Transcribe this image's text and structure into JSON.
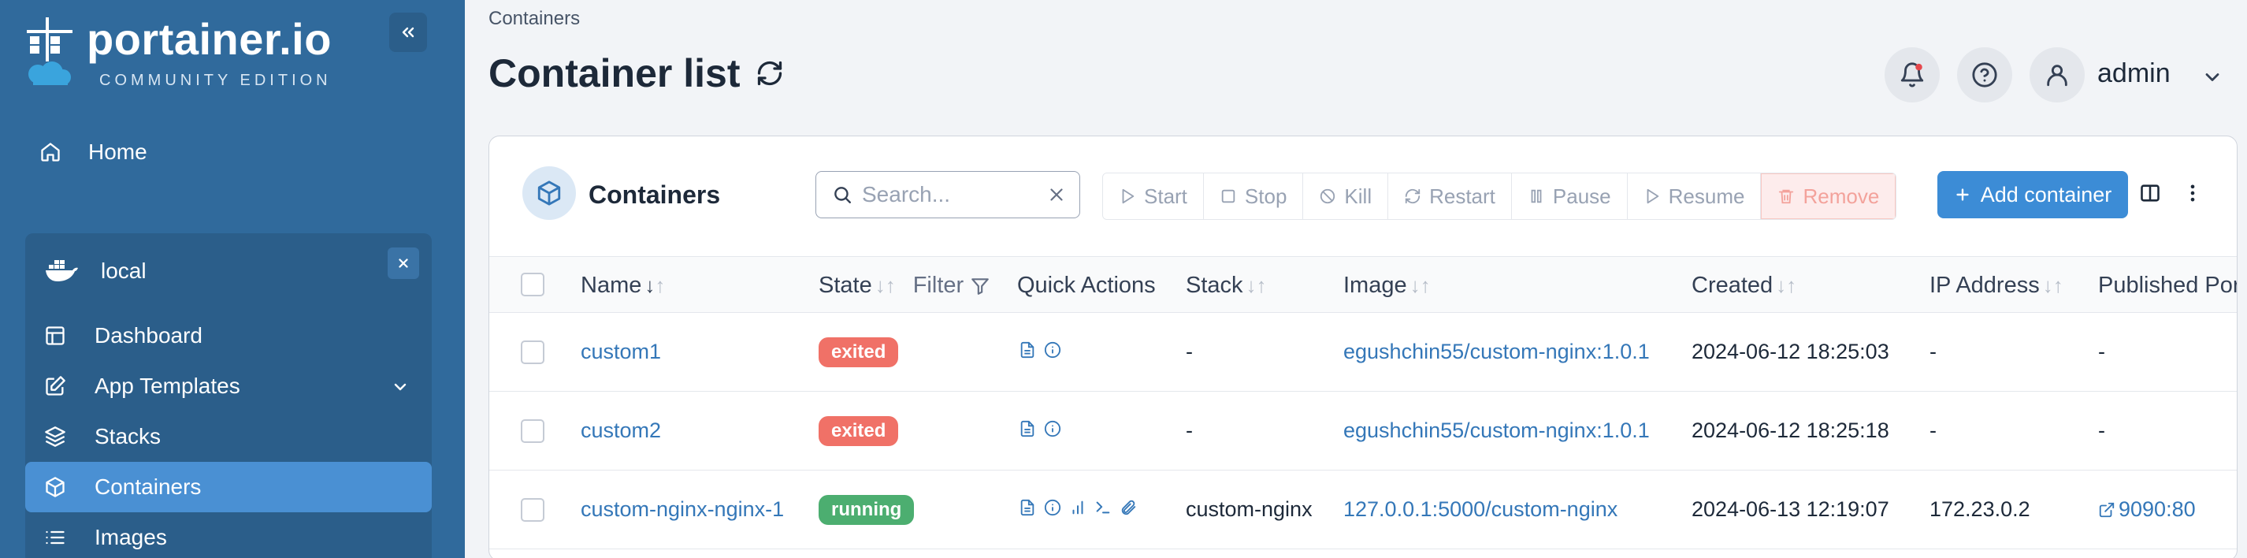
{
  "brand": {
    "name": "portainer.io",
    "edition": "COMMUNITY EDITION"
  },
  "sidebar": {
    "home_label": "Home",
    "environment": {
      "name": "local",
      "items": [
        {
          "label": "Dashboard",
          "icon": "dashboard-icon"
        },
        {
          "label": "App Templates",
          "icon": "edit-icon",
          "expandable": true
        },
        {
          "label": "Stacks",
          "icon": "layers-icon"
        },
        {
          "label": "Containers",
          "icon": "box-icon",
          "active": true
        },
        {
          "label": "Images",
          "icon": "list-icon"
        }
      ]
    }
  },
  "header": {
    "breadcrumb": "Containers",
    "title": "Container list",
    "user": "admin"
  },
  "card": {
    "title": "Containers",
    "search_placeholder": "Search...",
    "actions": {
      "start": "Start",
      "stop": "Stop",
      "kill": "Kill",
      "restart": "Restart",
      "pause": "Pause",
      "resume": "Resume",
      "remove": "Remove"
    },
    "add_label": "Add container"
  },
  "table": {
    "columns": {
      "name": "Name",
      "state": "State",
      "filter": "Filter",
      "quick_actions": "Quick Actions",
      "stack": "Stack",
      "image": "Image",
      "created": "Created",
      "ip": "IP Address",
      "ports": "Published Ports"
    },
    "rows": [
      {
        "name": "custom1",
        "state": "exited",
        "stack": "-",
        "image": "egushchin55/custom-nginx:1.0.1",
        "created": "2024-06-12 18:25:03",
        "ip": "-",
        "ports": "-"
      },
      {
        "name": "custom2",
        "state": "exited",
        "stack": "-",
        "image": "egushchin55/custom-nginx:1.0.1",
        "created": "2024-06-12 18:25:18",
        "ip": "-",
        "ports": "-"
      },
      {
        "name": "custom-nginx-nginx-1",
        "state": "running",
        "stack": "custom-nginx",
        "image": "127.0.0.1:5000/custom-nginx",
        "created": "2024-06-13 12:19:07",
        "ip": "172.23.0.2",
        "ports": "9090:80"
      }
    ]
  },
  "colors": {
    "sidebar": "#306a9c",
    "accent": "#3c8cd6",
    "exited": "#f07167",
    "running": "#4cae70"
  }
}
